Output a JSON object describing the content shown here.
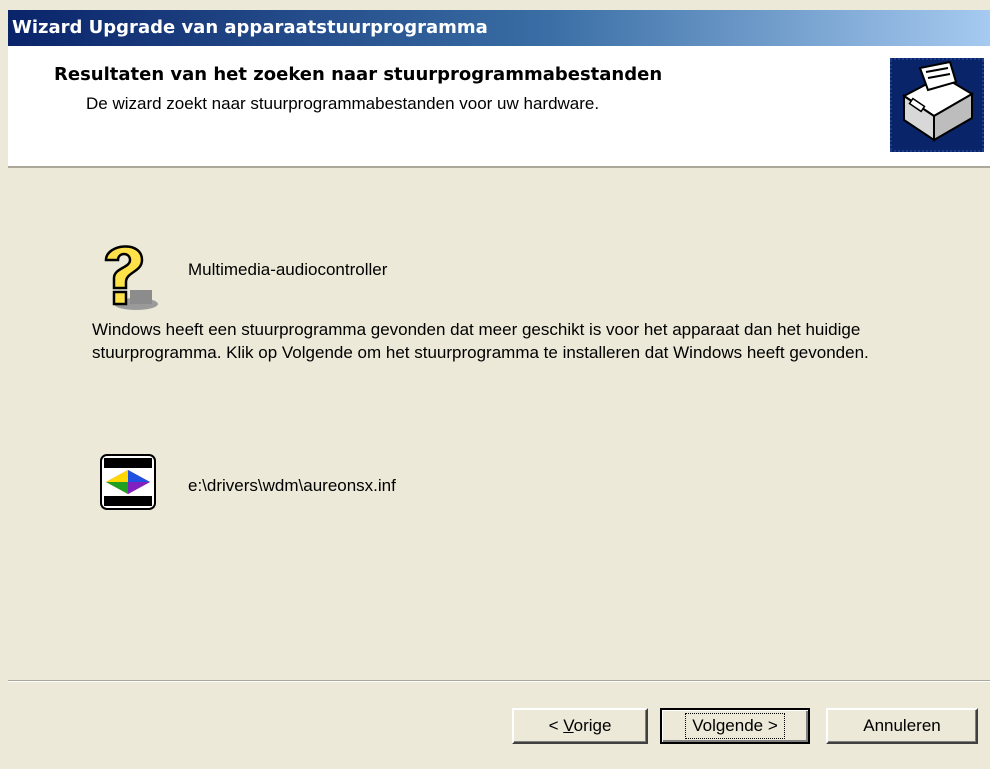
{
  "window": {
    "title": "Wizard Upgrade van apparaatstuurprogramma"
  },
  "header": {
    "title": "Resultaten van het zoeken naar stuurprogrammabestanden",
    "subtitle": "De wizard zoekt naar stuurprogrammabestanden voor uw hardware.",
    "icon": "hardware-wizard-icon"
  },
  "device": {
    "icon": "unknown-device-question-icon",
    "name": "Multimedia-audiocontroller"
  },
  "message": "Windows heeft een stuurprogramma gevonden dat meer geschikt is voor het apparaat dan het huidige stuurprogramma. Klik op Volgende om het stuurprogramma te installeren dat Windows heeft gevonden.",
  "driver": {
    "icon": "terratec-driver-icon",
    "path": "e:\\drivers\\wdm\\aureonsx.inf"
  },
  "buttons": {
    "back_prefix": "< ",
    "back_mnemonic": "V",
    "back_rest": "orige",
    "next_label": "Volgende >",
    "cancel_label": "Annuleren"
  },
  "colors": {
    "titlebar_start": "#0a246a",
    "titlebar_end": "#a6caf0",
    "dialog_bg": "#ece9d8",
    "header_bg": "#ffffff"
  }
}
